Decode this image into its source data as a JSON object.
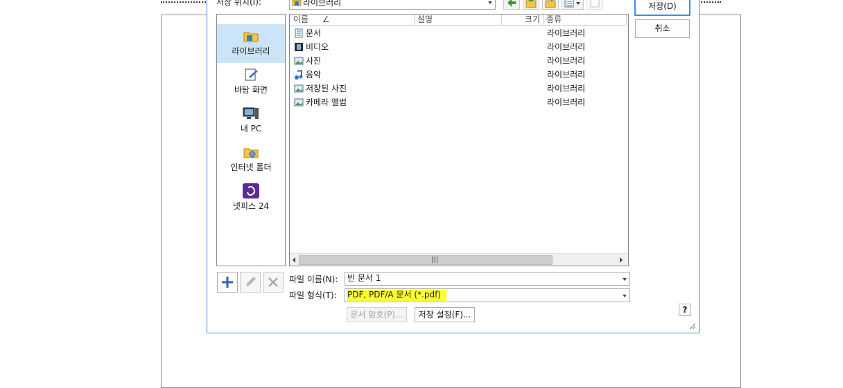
{
  "dialog": {
    "save_in_label": "저장 위치(I):",
    "location_value": "라이브러리",
    "save_button": "저장(D)",
    "cancel_button": "취소",
    "help_label": "?"
  },
  "sidebar": {
    "items": [
      {
        "label": "라이브러리",
        "icon": "library-folder-icon",
        "selected": true
      },
      {
        "label": "바탕 화면",
        "icon": "desktop-icon",
        "selected": false
      },
      {
        "label": "내 PC",
        "icon": "computer-icon",
        "selected": false
      },
      {
        "label": "인터넷 폴더",
        "icon": "internet-folder-icon",
        "selected": false
      },
      {
        "label": "넷피스 24",
        "icon": "netffice24-icon",
        "selected": false
      }
    ]
  },
  "file_list": {
    "columns": [
      "이름",
      "설명",
      "크기",
      "종류"
    ],
    "sort_indicator": "∠",
    "rows": [
      {
        "name": "문서",
        "type": "라이브러리",
        "icon": "documents-library-icon"
      },
      {
        "name": "비디오",
        "type": "라이브러리",
        "icon": "video-library-icon"
      },
      {
        "name": "사진",
        "type": "라이브러리",
        "icon": "pictures-library-icon"
      },
      {
        "name": "음악",
        "type": "라이브러리",
        "icon": "music-library-icon"
      },
      {
        "name": "저장된 사진",
        "type": "라이브러리",
        "icon": "saved-pictures-library-icon"
      },
      {
        "name": "카메라 앨범",
        "type": "라이브러리",
        "icon": "camera-roll-library-icon"
      }
    ],
    "scroll_grip": "|||"
  },
  "bottom": {
    "filename_label": "파일 이름(N):",
    "filename_value": "빈 문서 1",
    "filetype_label": "파일 형식(T):",
    "filetype_value": "PDF, PDF/A 문서 (*.pdf)",
    "doc_password_button": "문서 암호(P)...",
    "save_settings_button": "저장 설정(F)..."
  },
  "colors": {
    "accent": "#3c8ad8",
    "selection": "#cce4f7",
    "highlight": "#ffff33"
  }
}
